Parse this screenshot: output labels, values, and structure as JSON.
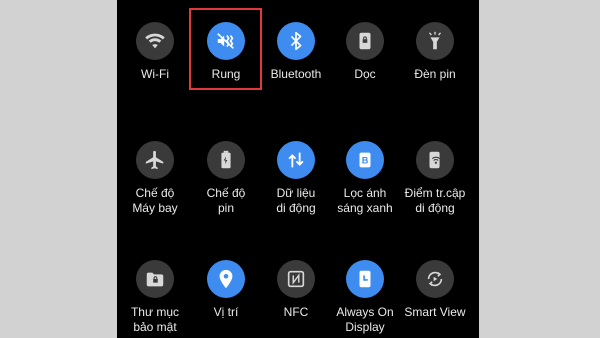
{
  "tiles": [
    {
      "id": "wifi",
      "label": "Wi-Fi",
      "icon": "wifi-icon",
      "active": false
    },
    {
      "id": "rung",
      "label": "Rung",
      "icon": "vibrate-icon",
      "active": true
    },
    {
      "id": "bluetooth",
      "label": "Bluetooth",
      "icon": "bluetooth-icon",
      "active": true
    },
    {
      "id": "doc",
      "label": "Dọc",
      "icon": "portrait-lock-icon",
      "active": false
    },
    {
      "id": "den-pin",
      "label": "Đèn pin",
      "icon": "flashlight-icon",
      "active": false
    },
    {
      "id": "may-bay",
      "label": "Chế độ\nMáy bay",
      "icon": "airplane-icon",
      "active": false
    },
    {
      "id": "tiet-kiem-pin",
      "label": "Chế độ\npin",
      "icon": "battery-saver-icon",
      "active": false
    },
    {
      "id": "du-lieu",
      "label": "Dữ liệu\ndi động",
      "icon": "mobile-data-icon",
      "active": true
    },
    {
      "id": "loc-anh-sang",
      "label": "Lọc ánh\nsáng xanh",
      "icon": "blue-light-filter-icon",
      "active": true
    },
    {
      "id": "diem-truy-cap",
      "label": "Điểm tr.cập\ndi động",
      "icon": "hotspot-icon",
      "active": false
    },
    {
      "id": "thu-muc-bao-mat",
      "label": "Thư mục\nbảo mật",
      "icon": "secure-folder-icon",
      "active": false
    },
    {
      "id": "vi-tri",
      "label": "Vị trí",
      "icon": "location-icon",
      "active": true
    },
    {
      "id": "nfc",
      "label": "NFC",
      "icon": "nfc-icon",
      "active": false
    },
    {
      "id": "always-on",
      "label": "Always On\nDisplay",
      "icon": "always-on-display-icon",
      "active": true
    },
    {
      "id": "smart-view",
      "label": "Smart View",
      "icon": "smart-view-icon",
      "active": false
    }
  ],
  "colors": {
    "active": "#3f8cf0",
    "inactive": "#3a3a3a",
    "highlight": "#e03a3a"
  }
}
